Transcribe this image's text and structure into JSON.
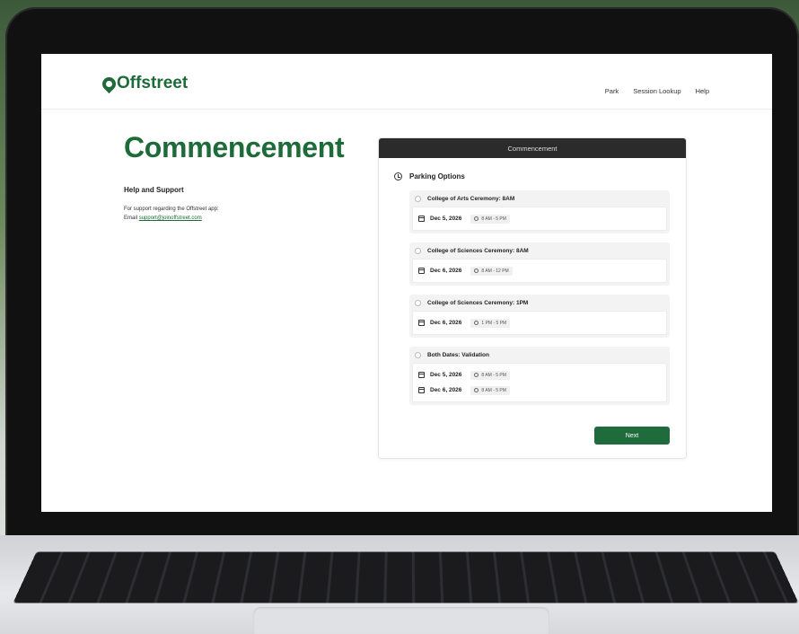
{
  "header": {
    "logo_text": "Offstreet",
    "nav": [
      "Park",
      "Session Lookup",
      "Help"
    ]
  },
  "page": {
    "title": "Commencement",
    "help_title": "Help and Support",
    "help_line1": "For support regarding the Offstreet app:",
    "help_email_prefix": "Email",
    "help_email": "support@joinoffstreet.com"
  },
  "card": {
    "header": "Commencement",
    "section_title": "Parking Options",
    "options": [
      {
        "label": "College of Arts Ceremony: 8AM",
        "dates": [
          {
            "date": "Dec 5, 2026",
            "time": "8 AM - 5 PM"
          }
        ]
      },
      {
        "label": "College of Sciences Ceremony: 8AM",
        "dates": [
          {
            "date": "Dec 6, 2026",
            "time": "8 AM - 12 PM"
          }
        ]
      },
      {
        "label": "College of Sciences Ceremony: 1PM",
        "dates": [
          {
            "date": "Dec 6, 2026",
            "time": "1 PM - 5 PM"
          }
        ]
      },
      {
        "label": "Both Dates: Validation",
        "dates": [
          {
            "date": "Dec 5, 2026",
            "time": "8 AM - 5 PM"
          },
          {
            "date": "Dec 6, 2026",
            "time": "8 AM - 5 PM"
          }
        ]
      }
    ],
    "next_label": "Next"
  },
  "colors": {
    "brand_green": "#1e6b3a",
    "button_green": "#1f6b3b",
    "card_header": "#2b2b2b"
  },
  "icons": [
    "location-pin-icon",
    "clock-icon",
    "calendar-icon"
  ]
}
